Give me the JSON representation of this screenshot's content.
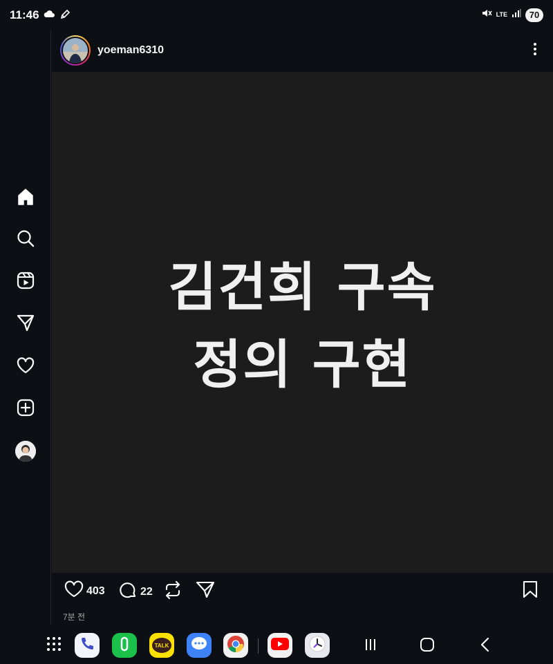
{
  "status_bar": {
    "time": "11:46",
    "network": "LTE",
    "battery": "70"
  },
  "post": {
    "username": "yoeman6310",
    "image_text_line1": "김건희 구속",
    "image_text_line2": "정의 구현",
    "likes": "403",
    "comments": "22",
    "time_ago": "7분 전"
  },
  "nav_rail": [
    "home-icon",
    "search-icon",
    "reels-icon",
    "messages-icon",
    "notifications-icon",
    "create-icon",
    "profile-avatar"
  ],
  "dock": {
    "apps": [
      "phone",
      "call-app",
      "kakaotalk",
      "messages",
      "chrome",
      "youtube",
      "clock"
    ],
    "kakao_label": "TALK"
  },
  "colors": {
    "background": "#0c1014",
    "post_image_bg": "#1c1c1c",
    "text": "#f5f5f5",
    "muted": "#a8a8a8"
  }
}
